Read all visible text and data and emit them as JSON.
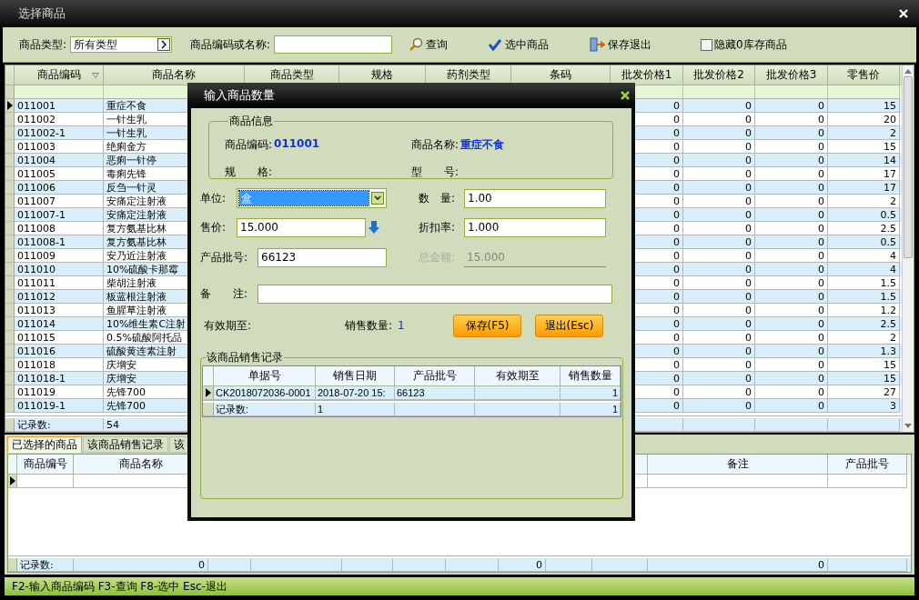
{
  "window": {
    "title": "选择商品"
  },
  "toolbar": {
    "category_label": "商品类型:",
    "category_value": "所有类型",
    "search_label": "商品编码或名称:",
    "buttons": [
      {
        "kind": "search",
        "label": "查询"
      },
      {
        "kind": "select",
        "label": "选中商品"
      },
      {
        "kind": "exit",
        "label": "保存退出"
      }
    ],
    "hide_zero_stock": {
      "label": "隐藏0库存商品",
      "checked": false
    }
  },
  "goods_table": {
    "columns": [
      "商品编码",
      "商品名称",
      "商品类型",
      "规格",
      "药剂类型",
      "条码",
      "批发价格1",
      "批发价格2",
      "批发价格3",
      "零售价"
    ],
    "rows": [
      {
        "code": "011001",
        "name": "重症不食",
        "wholesale_1": "0",
        "wholesale_2": "0",
        "wholesale_3": "0",
        "retail": "15",
        "selected": true
      },
      {
        "code": "011002",
        "name": "一针生乳",
        "wholesale_1": "0",
        "wholesale_2": "0",
        "wholesale_3": "0",
        "retail": "20",
        "selected": false
      },
      {
        "code": "011002-1",
        "name": "一针生乳",
        "wholesale_1": "0",
        "wholesale_2": "0",
        "wholesale_3": "0",
        "retail": "2",
        "selected": false
      },
      {
        "code": "011003",
        "name": "绝痢金方",
        "wholesale_1": "0",
        "wholesale_2": "0",
        "wholesale_3": "0",
        "retail": "15",
        "selected": false
      },
      {
        "code": "011004",
        "name": "恶痢一针停",
        "wholesale_1": "0",
        "wholesale_2": "0",
        "wholesale_3": "0",
        "retail": "14",
        "selected": false
      },
      {
        "code": "011005",
        "name": "毒痢先锋",
        "wholesale_1": "0",
        "wholesale_2": "0",
        "wholesale_3": "0",
        "retail": "17",
        "selected": false
      },
      {
        "code": "011006",
        "name": "反刍一针灵",
        "wholesale_1": "0",
        "wholesale_2": "0",
        "wholesale_3": "0",
        "retail": "17",
        "selected": false
      },
      {
        "code": "011007",
        "name": "安痛定注射液",
        "wholesale_1": "0",
        "wholesale_2": "0",
        "wholesale_3": "0",
        "retail": "2",
        "selected": false
      },
      {
        "code": "011007-1",
        "name": "安痛定注射液",
        "wholesale_1": "0",
        "wholesale_2": "0",
        "wholesale_3": "0",
        "retail": "0.5",
        "selected": false
      },
      {
        "code": "011008",
        "name": "复方氨基比林",
        "wholesale_1": "0",
        "wholesale_2": "0",
        "wholesale_3": "0",
        "retail": "2.5",
        "selected": false
      },
      {
        "code": "011008-1",
        "name": "复方氨基比林",
        "wholesale_1": "0",
        "wholesale_2": "0",
        "wholesale_3": "0",
        "retail": "0.5",
        "selected": false
      },
      {
        "code": "011009",
        "name": "安乃近注射液",
        "wholesale_1": "0",
        "wholesale_2": "0",
        "wholesale_3": "0",
        "retail": "4",
        "selected": false
      },
      {
        "code": "011010",
        "name": "10%硫酸卡那霉",
        "wholesale_1": "0",
        "wholesale_2": "0",
        "wholesale_3": "0",
        "retail": "4",
        "selected": false
      },
      {
        "code": "011011",
        "name": "柴胡注射液",
        "wholesale_1": "0",
        "wholesale_2": "0",
        "wholesale_3": "0",
        "retail": "1.5",
        "selected": false
      },
      {
        "code": "011012",
        "name": "板蓝根注射液",
        "wholesale_1": "0",
        "wholesale_2": "0",
        "wholesale_3": "0",
        "retail": "1.5",
        "selected": false
      },
      {
        "code": "011013",
        "name": "鱼腥草注射液",
        "wholesale_1": "0",
        "wholesale_2": "0",
        "wholesale_3": "0",
        "retail": "1.2",
        "selected": false
      },
      {
        "code": "011014",
        "name": "10%维生素C注射",
        "wholesale_1": "0",
        "wholesale_2": "0",
        "wholesale_3": "0",
        "retail": "2.5",
        "selected": false
      },
      {
        "code": "011015",
        "name": "0.5%硫酸阿托品",
        "wholesale_1": "0",
        "wholesale_2": "0",
        "wholesale_3": "0",
        "retail": "2",
        "selected": false
      },
      {
        "code": "011016",
        "name": "硫酸黄连素注射",
        "wholesale_1": "0",
        "wholesale_2": "0",
        "wholesale_3": "0",
        "retail": "1.3",
        "selected": false
      },
      {
        "code": "011018",
        "name": "庆增安",
        "wholesale_1": "0",
        "wholesale_2": "0",
        "wholesale_3": "0",
        "retail": "15",
        "selected": false
      },
      {
        "code": "011018-1",
        "name": "庆增安",
        "wholesale_1": "0",
        "wholesale_2": "0",
        "wholesale_3": "0",
        "retail": "15",
        "selected": false
      },
      {
        "code": "011019",
        "name": "先锋700",
        "wholesale_1": "0",
        "wholesale_2": "0",
        "wholesale_3": "0",
        "retail": "27",
        "selected": false
      },
      {
        "code": "011019-1",
        "name": "先锋700",
        "wholesale_1": "0",
        "wholesale_2": "0",
        "wholesale_3": "0",
        "retail": "3",
        "selected": false
      }
    ],
    "footer": {
      "label": "记录数:",
      "count": "54"
    }
  },
  "lower_panel": {
    "tabs": [
      {
        "label": "已选择的商品",
        "selected": true
      },
      {
        "label": "该商品销售记录",
        "selected": false
      },
      {
        "label": "该",
        "selected": false
      }
    ],
    "columns_left": [
      "商品编号",
      "商品名称"
    ],
    "columns_right": [
      "备注",
      "产品批号"
    ],
    "rows": [
      {
        "selected": true
      }
    ],
    "footer": {
      "label": "记录数:",
      "count": "0",
      "total_1": "0",
      "total_2": "0"
    }
  },
  "status_bar": "F2-输入商品编码 F3-查询 F8-选中 Esc-退出",
  "dialog": {
    "title": "输入商品数量",
    "info": {
      "title": "商品信息",
      "code_label": "商品编码:",
      "code": "011001",
      "name_label": "商品名称:",
      "name": "重症不食",
      "spec_label": "规　　格:",
      "model_label": "型　　号:"
    },
    "unit": {
      "label": "单位:",
      "value": "盒"
    },
    "quantity": {
      "label": "数　量:",
      "value": "1.00"
    },
    "price": {
      "label": "售价:",
      "value": "15.000"
    },
    "discount": {
      "label": "折扣率:",
      "value": "1.000"
    },
    "batch": {
      "label": "产品批号:",
      "value": "66123"
    },
    "total": {
      "label": "总金额:",
      "value": "15.000",
      "disabled": true
    },
    "note": {
      "label": "备　　注:"
    },
    "expiry": {
      "label": "有效期至:"
    },
    "sold": {
      "label": "销售数量:",
      "value": "1"
    },
    "buttons": [
      {
        "label": "保存(F5)"
      },
      {
        "label": "退出(Esc)"
      }
    ],
    "history": {
      "title": "该商品销售记录",
      "columns": [
        "单据号",
        "销售日期",
        "产品批号",
        "有效期至",
        "销售数量"
      ],
      "rows": [
        {
          "doc_no": "CK2018072036-0001",
          "date": "2018-07-20 15:",
          "batch": "66123",
          "qty": "1",
          "selected": true
        }
      ],
      "footer": {
        "label": "记录数:",
        "count": "1",
        "qty": "1"
      }
    }
  }
}
